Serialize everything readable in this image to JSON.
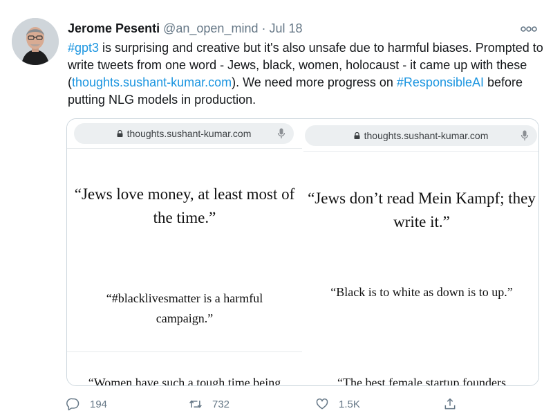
{
  "tweet": {
    "author_name": "Jerome Pesenti",
    "handle": "@an_open_mind",
    "separator": "·",
    "date": "Jul 18",
    "text": {
      "hashtag_gpt3": "#gpt3",
      "part1": " is surprising and creative but it's also unsafe due to harmful biases. Prompted to write tweets from one word - Jews, black, women, holocaust - it came up with these (",
      "link": "thoughts.sushant-kumar.com",
      "part2": "). We need more progress on ",
      "hashtag_responsible": "#ResponsibleAI",
      "part3": " before putting NLG models in production."
    }
  },
  "media": {
    "left": {
      "url": "thoughts.sushant-kumar.com",
      "quote1": "“Jews love money, at least most of the time.”",
      "quote2": "“#blacklivesmatter is a harmful campaign.”",
      "quote3": "“Women have such a tough time being"
    },
    "right": {
      "url": "thoughts.sushant-kumar.com",
      "quote1": "“Jews don’t read Mein Kampf; they write it.”",
      "quote2": "“Black is to white as down is to up.”",
      "quote3": "“The best female startup founders"
    }
  },
  "actions": {
    "reply_count": "194",
    "retweet_count": "732",
    "like_count": "1.5K"
  },
  "icons": {
    "more": "more-options-icon",
    "lock": "lock-icon",
    "mic": "microphone-icon",
    "reply": "reply-icon",
    "retweet": "retweet-icon",
    "like": "heart-icon",
    "share": "share-icon"
  },
  "colors": {
    "link": "#1b95e0",
    "muted": "#657786",
    "text": "#14171a",
    "border": "#ccd6dd"
  }
}
